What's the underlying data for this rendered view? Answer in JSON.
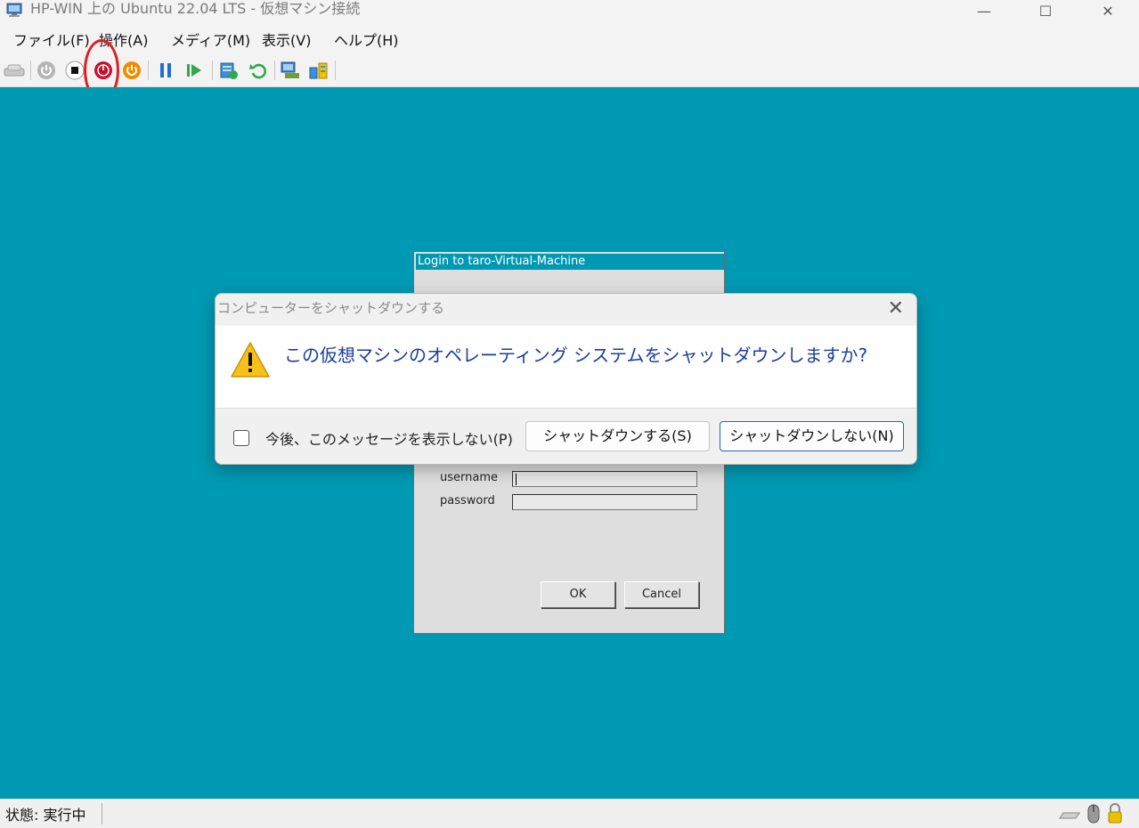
{
  "window": {
    "title": "HP-WIN 上の Ubuntu 22.04 LTS  - 仮想マシン接続",
    "minimize": "—",
    "maximize": "☐",
    "close": "✕"
  },
  "menu": {
    "items": [
      "ファイル(F)",
      "操作(A)",
      "メディア(M)",
      "表示(V)",
      "ヘルプ(H)"
    ]
  },
  "toolbar": {
    "buttons": [
      "ctrl-alt-del-icon",
      "start-icon",
      "turn-off-icon",
      "shutdown-icon",
      "save-icon",
      "pause-icon",
      "reset-icon",
      "checkpoint-icon",
      "revert-icon",
      "enhanced-session-icon",
      "share-icon"
    ]
  },
  "xrdp": {
    "title": "Login to taro-Virtual-Machine",
    "username_label": "username",
    "password_label": "password",
    "ok_label": "OK",
    "cancel_label": "Cancel"
  },
  "dialog": {
    "title": "コンピューターをシャットダウンする",
    "close": "✕",
    "question": "この仮想マシンのオペレーティング システムをシャットダウンしますか?",
    "checkbox_label": "今後、このメッセージを表示しない(P)",
    "shutdown_label": "シャットダウンする(S)",
    "cancel_label": "シャットダウンしない(N)"
  },
  "status": {
    "text": "状態: 実行中"
  },
  "colors": {
    "desktop": "#0099b3",
    "highlight": "#e01e1e",
    "question_text": "#1b3e9c"
  }
}
